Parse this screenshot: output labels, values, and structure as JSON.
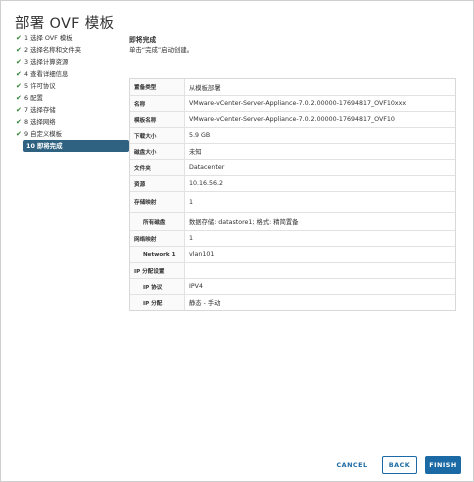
{
  "dialog": {
    "title": "部署 OVF 模板"
  },
  "steps": [
    {
      "number": "1",
      "label": "选择 OVF 模板",
      "done": true
    },
    {
      "number": "2",
      "label": "选择名称和文件夹",
      "done": true
    },
    {
      "number": "3",
      "label": "选择计算资源",
      "done": true
    },
    {
      "number": "4",
      "label": "查看详细信息",
      "done": true
    },
    {
      "number": "5",
      "label": "许可协议",
      "done": true
    },
    {
      "number": "6",
      "label": "配置",
      "done": true
    },
    {
      "number": "7",
      "label": "选择存储",
      "done": true
    },
    {
      "number": "8",
      "label": "选择网络",
      "done": true
    },
    {
      "number": "9",
      "label": "自定义模板",
      "done": true
    },
    {
      "number": "10",
      "label": "即将完成",
      "done": false,
      "active": true
    }
  ],
  "main": {
    "title": "即将完成",
    "description": "单击“完成”启动创建。"
  },
  "summary": [
    {
      "label": "置备类型",
      "value": "从模板部署"
    },
    {
      "label": "名称",
      "value": "VMware-vCenter-Server-Appliance-7.0.2.00000-17694817_OVF10xxx"
    },
    {
      "label": "模板名称",
      "value": "VMware-vCenter-Server-Appliance-7.0.2.00000-17694817_OVF10"
    },
    {
      "label": "下载大小",
      "value": "5.9 GB"
    },
    {
      "label": "磁盘大小",
      "value": "未知"
    },
    {
      "label": "文件夹",
      "value": "Datacenter"
    },
    {
      "label": "资源",
      "value": "10.16.56.2"
    },
    {
      "label": "存储映射",
      "value": "1"
    },
    {
      "label": "所有磁盘",
      "value": "数据存储: datastore1; 格式: 精简置备",
      "indent": true
    },
    {
      "label": "网络映射",
      "value": "1"
    },
    {
      "label": "Network 1",
      "value": "vlan101",
      "indent": true
    },
    {
      "label": "IP 分配设置",
      "value": ""
    },
    {
      "label": "IP 协议",
      "value": "IPV4",
      "indent": true
    },
    {
      "label": "IP 分配",
      "value": "静态 - 手动",
      "indent": true
    }
  ],
  "footer": {
    "cancel_label": "CANCEL",
    "back_label": "BACK",
    "finish_label": "FINISH"
  },
  "colors": {
    "accent": "#1b6aa5",
    "active_step": "#2f6280",
    "check": "#2e7d32"
  }
}
